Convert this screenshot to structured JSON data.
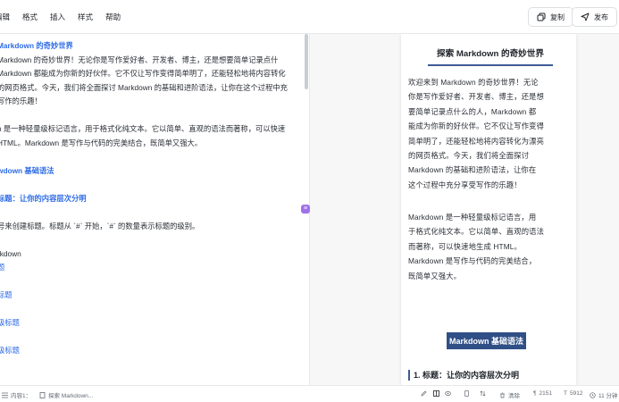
{
  "menu": [
    "编辑",
    "格式",
    "插入",
    "样式",
    "帮助"
  ],
  "toolbar": {
    "copy_label": "复制",
    "publish_label": "发布"
  },
  "editor": {
    "lines": [
      {
        "text": "Markdown 的奇妙世界",
        "style": "h"
      },
      {
        "text": "Markdown 的奇妙世界！无论你是写作爱好者、开发者、博主，还是想要简单记录点什",
        "style": ""
      },
      {
        "text": "Markdown 都能成为你新的好伙伴。它不仅让写作变得简单明了，还能轻松地将内容转化",
        "style": ""
      },
      {
        "text": "的网页格式。今天，我们将全面探讨 Markdown 的基础和进阶语法，让你在这个过程中充",
        "style": ""
      },
      {
        "text": "写作的乐趣！",
        "style": ""
      },
      {
        "text": "",
        "style": ""
      },
      {
        "text": "n 是一种轻量级标记语言，用于格式化纯文本。它以简单、直观的语法而著称，可以快速",
        "style": ""
      },
      {
        "text": "HTML。Markdown 是写作与代码的完美结合，既简单又强大。",
        "style": ""
      },
      {
        "text": "",
        "style": ""
      },
      {
        "text": "wdown 基础语法",
        "style": "h"
      },
      {
        "text": "",
        "style": ""
      },
      {
        "text": "标题：让你的内容层次分明",
        "style": "h"
      },
      {
        "text": "",
        "style": ""
      },
      {
        "text": "号来创建标题。标题从 `#` 开始，`#` 的数量表示标题的级别。",
        "style": ""
      },
      {
        "text": "",
        "style": ""
      },
      {
        "text": "rkdown",
        "style": ""
      },
      {
        "text": "题",
        "style": "blue"
      },
      {
        "text": "",
        "style": ""
      },
      {
        "text": "标题",
        "style": "blue"
      },
      {
        "text": "",
        "style": ""
      },
      {
        "text": "级标题",
        "style": "blue"
      },
      {
        "text": "",
        "style": ""
      },
      {
        "text": "级标题",
        "style": "blue"
      },
      {
        "text": "",
        "style": ""
      },
      {
        "text": "",
        "style": ""
      }
    ]
  },
  "preview": {
    "title": "探索 Markdown 的奇妙世界",
    "para1": [
      "欢迎来到 Markdown 的奇妙世界！无论",
      "你是写作爱好者、开发者、博主，还是想",
      "要简单记录点什么的人，Markdown 都",
      "能成为你新的好伙伴。它不仅让写作变得",
      "简单明了，还能轻松地将内容转化为漂亮",
      "的网页格式。今天，我们将全面探讨",
      "Markdown 的基础和进阶语法，让你在",
      "这个过程中充分享受写作的乐趣！"
    ],
    "para2": [
      "Markdown 是一种轻量级标记语言，用",
      "于格式化纯文本。它以简单、直观的语法",
      "而著称，可以快速地生成 HTML。",
      "Markdown 是写作与代码的完美结合，",
      "既简单又强大。"
    ],
    "h2": "Markdown 基础语法",
    "h3": "1. 标题：让你的内容层次分明"
  },
  "status": {
    "outline": "内容1：",
    "doc_tab": "探索 Markdown...",
    "clear": "清除",
    "words": "2151",
    "chars": "5912",
    "time": "11 分钟"
  },
  "colors": {
    "accent": "#2e6be6",
    "heading_bg": "#2f4f86",
    "handle": "#a071e8"
  }
}
